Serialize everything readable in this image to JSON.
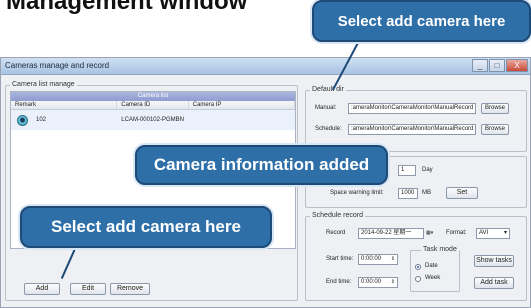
{
  "slide": {
    "title": "Management window"
  },
  "window": {
    "title": "Cameras manage and record",
    "controls": [
      "_",
      "□",
      "X"
    ]
  },
  "camera_list": {
    "group_label": "Camera list manage",
    "table_title": "Camera list",
    "columns": [
      "Remark",
      "Camera ID",
      "Camera IP"
    ],
    "rows": [
      {
        "remark": "102",
        "camera_id": "LCAM-000102-PGMBN",
        "camera_ip": ""
      }
    ],
    "buttons": {
      "add": "Add",
      "edit": "Edit",
      "remove": "Remove"
    }
  },
  "default_dir": {
    "group_label": "Default dir",
    "manual_label": "Manual:",
    "manual_value": ":ameraMonitor\\CameraMonitor\\ManualRecord",
    "schedule_label": "Schedule:",
    "schedule_value": ":ameraMonitor\\CameraMonitor\\ManualRecord",
    "browse_label": "Browse"
  },
  "storage": {
    "day_value": "1",
    "day_unit": "Day",
    "space_label": "Space warning limit:",
    "space_value": "1000",
    "space_unit": "MB",
    "set_label": "Set"
  },
  "schedule": {
    "group_label": "Schedule record",
    "record_label": "Record",
    "date_value": "2014-09-22",
    "weekday_value": "星期一",
    "format_label": "Format:",
    "format_value": "AVI",
    "start_label": "Start time:",
    "start_value": "0:00:00",
    "end_label": "End time:",
    "end_value": "0:00:00",
    "task_mode_label": "Task mode",
    "mode_date": "Date",
    "mode_week": "Week",
    "show_tasks": "Show tasks",
    "add_task": "Add task"
  },
  "callouts": {
    "top": "Select add camera here",
    "middle": "Camera information added",
    "bottom": "Select add camera here"
  },
  "colors": {
    "callout_fill": "#2f6fa8",
    "callout_border": "#1d4a77",
    "list_header": "#8e9ccf"
  }
}
